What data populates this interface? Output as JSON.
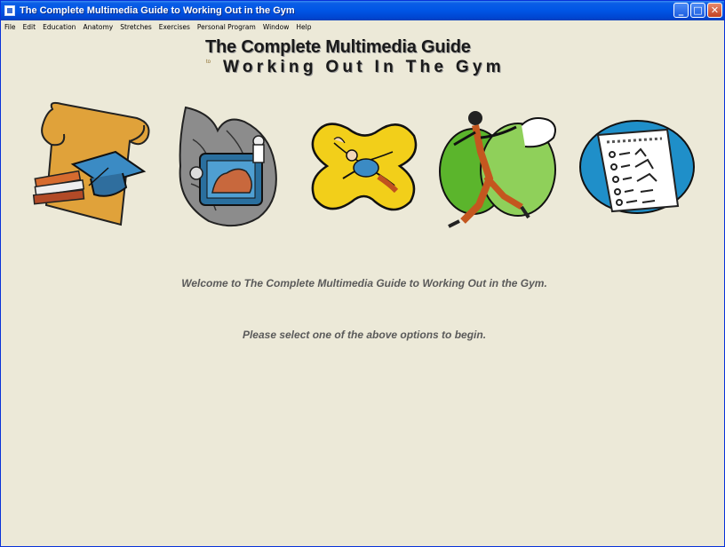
{
  "window": {
    "title": "The Complete Multimedia Guide to Working Out in the Gym",
    "controls": [
      "minimize-icon",
      "maximize-icon",
      "close-icon"
    ]
  },
  "menu": {
    "items": [
      "File",
      "Edit",
      "Education",
      "Anatomy",
      "Stretches",
      "Exercises",
      "Personal Program",
      "Window",
      "Help"
    ]
  },
  "heading": {
    "line1": "The Complete Multimedia Guide",
    "mark": "to",
    "line2": "Working Out In The Gym"
  },
  "options": [
    {
      "icon": "education-scroll-icon"
    },
    {
      "icon": "anatomy-heart-icon"
    },
    {
      "icon": "stretches-figure-icon"
    },
    {
      "icon": "exercises-runner-icon"
    },
    {
      "icon": "personal-program-chart-icon"
    }
  ],
  "welcome": "Welcome to The Complete Multimedia Guide to Working Out in the Gym.",
  "instruction": "Please select one of the above options to begin.",
  "colors": {
    "titlebar": "#0055e5",
    "background": "#ece9d8",
    "text": "#5a5a5a"
  }
}
